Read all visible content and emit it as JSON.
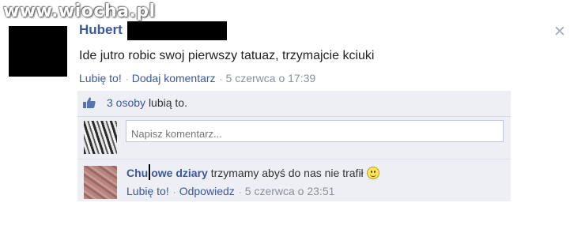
{
  "watermark": "www.wiocha.pl",
  "post": {
    "author": "Hubert",
    "status": "Ide jutro robic swoj pierwszy tatuaz, trzymajcie kciuki",
    "like_label": "Lubię to!",
    "comment_label": "Dodaj komentarz",
    "timestamp": "5 czerwca o 17:39"
  },
  "likes": {
    "count_label": "3 osoby",
    "suffix": "lubią to."
  },
  "comment_box": {
    "placeholder": "Napisz komentarz..."
  },
  "reply": {
    "author_part1": "Chu",
    "author_part2": "owe dziary",
    "text": "trzymamy abyś do nas nie trafił",
    "like_label": "Lubię to!",
    "reply_label": "Odpowiedz",
    "timestamp": "5 czerwca o 23:51"
  },
  "icons": {
    "close": "close-icon",
    "thumb": "thumbs-up-icon",
    "smiley": "smiley-icon"
  },
  "colors": {
    "link": "#3b5998",
    "panel": "#edeff4",
    "meta": "#8a8f9c"
  }
}
